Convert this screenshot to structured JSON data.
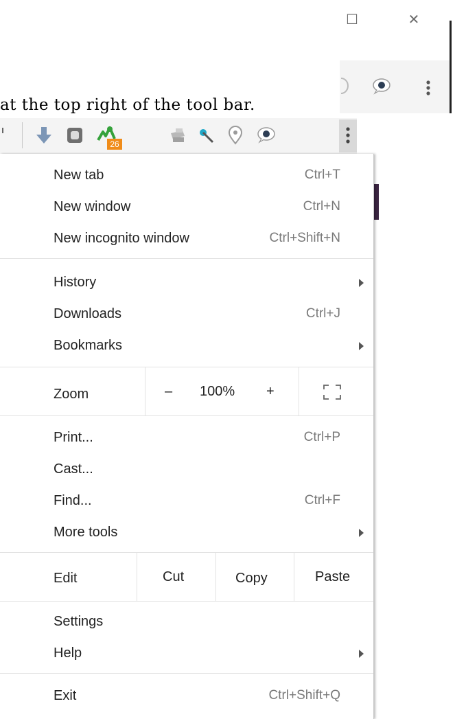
{
  "window_controls": {
    "maximize_glyph": "☐",
    "close_glyph": "✕"
  },
  "caption": "at the top right of the tool bar.",
  "toolbar": {
    "extension_badge": "26",
    "icons": [
      "download-icon",
      "extension-gray-icon",
      "extension-green-icon",
      "extension-printer-icon",
      "extension-eyedropper-icon",
      "extension-pin-icon",
      "extension-speech-bubble-icon",
      "more-vertical-icon"
    ]
  },
  "menu": {
    "new_tab": {
      "label": "New tab",
      "shortcut": "Ctrl+T"
    },
    "new_window": {
      "label": "New window",
      "shortcut": "Ctrl+N"
    },
    "new_incognito": {
      "label": "New incognito window",
      "shortcut": "Ctrl+Shift+N"
    },
    "history": {
      "label": "History"
    },
    "downloads": {
      "label": "Downloads",
      "shortcut": "Ctrl+J"
    },
    "bookmarks": {
      "label": "Bookmarks"
    },
    "zoom": {
      "label": "Zoom",
      "minus": "–",
      "value": "100%",
      "plus": "+"
    },
    "print": {
      "label": "Print...",
      "shortcut": "Ctrl+P"
    },
    "cast": {
      "label": "Cast..."
    },
    "find": {
      "label": "Find...",
      "shortcut": "Ctrl+F"
    },
    "more_tools": {
      "label": "More tools"
    },
    "edit": {
      "label": "Edit",
      "cut": "Cut",
      "copy": "Copy",
      "paste": "Paste"
    },
    "settings": {
      "label": "Settings"
    },
    "help": {
      "label": "Help"
    },
    "exit": {
      "label": "Exit",
      "shortcut": "Ctrl+Shift+Q"
    }
  }
}
